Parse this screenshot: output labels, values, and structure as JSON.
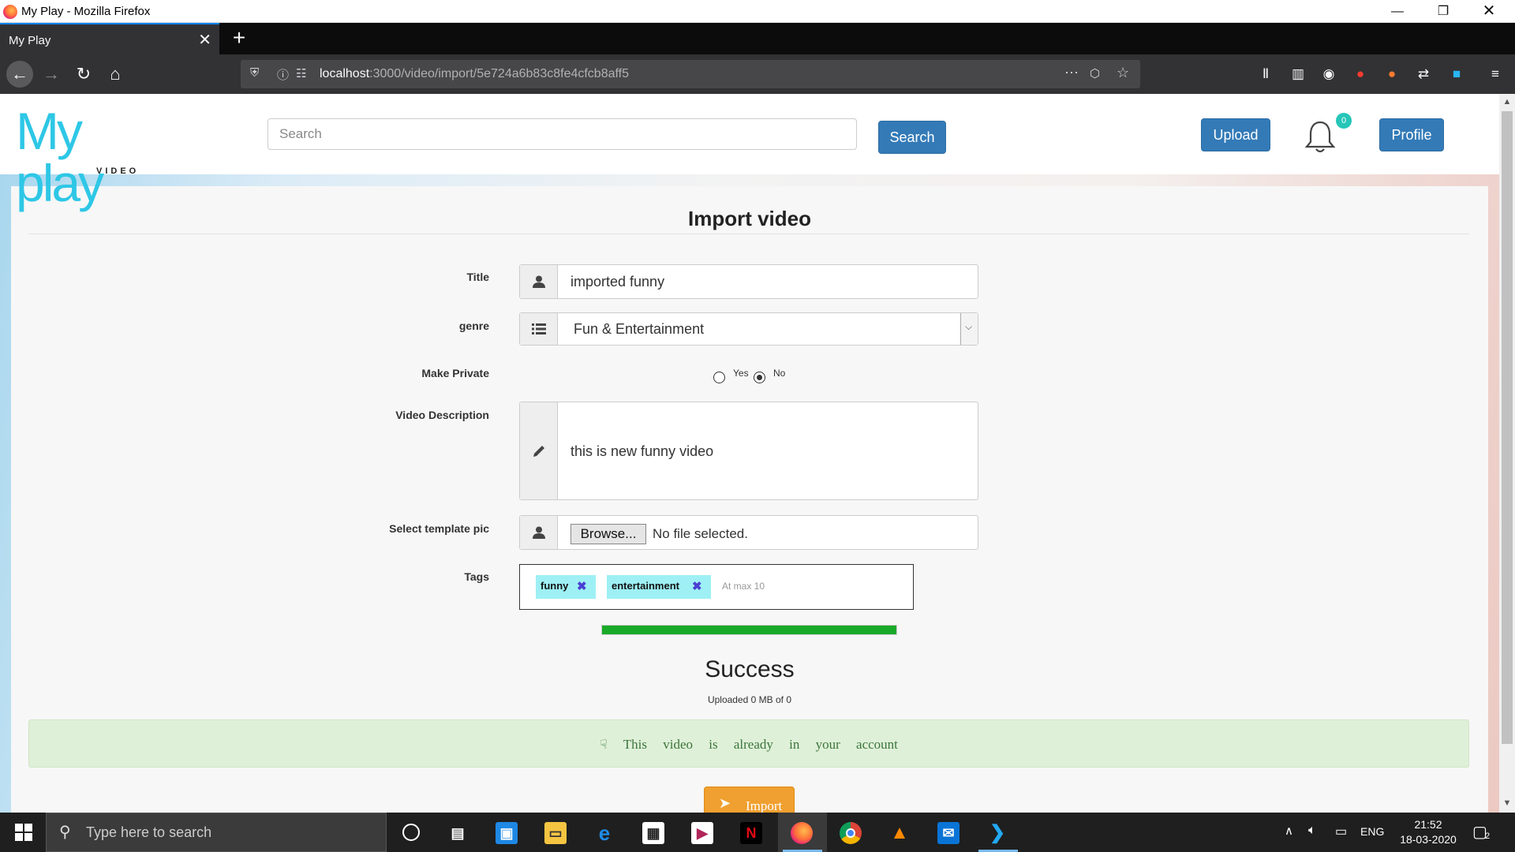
{
  "window": {
    "title": "My Play - Mozilla Firefox"
  },
  "tab": {
    "label": "My Play"
  },
  "url": {
    "host": "localhost",
    "rest": ":3000/video/import/5e724a6b83c8fe4cfcb8aff5"
  },
  "header": {
    "logo_main": "My play",
    "logo_sub": "VIDEO",
    "search_placeholder": "Search",
    "search_button": "Search",
    "upload_button": "Upload",
    "notification_count": "0",
    "profile_button": "Profile"
  },
  "form": {
    "heading": "Import video",
    "title_label": "Title",
    "title_value": "imported funny",
    "genre_label": "genre",
    "genre_value": "Fun & Entertainment",
    "private_label": "Make Private",
    "private_yes": "Yes",
    "private_no": "No",
    "private_selected": "No",
    "description_label": "Video Description",
    "description_value": "this is new funny video",
    "template_label": "Select template pic",
    "browse_button": "Browse...",
    "file_status": "No file selected.",
    "tags_label": "Tags",
    "tags": [
      {
        "text": "funny"
      },
      {
        "text": "entertainment"
      }
    ],
    "tags_placeholder": "At max 10",
    "progress": 1.0,
    "status": "Success",
    "uploaded_text": "Uploaded 0 MB of 0",
    "alert_text": "This video is already in your account",
    "import_button": "Import"
  },
  "taskbar": {
    "search_placeholder": "Type here to search",
    "language": "ENG",
    "time": "21:52",
    "date": "18-03-2020",
    "notification_count": "2"
  },
  "colors": {
    "accent_blue": "#337ab7",
    "logo_cyan": "#2ec7e6",
    "success_green": "#1aaa2a",
    "alert_bg": "#dff0d8",
    "import_orange": "#f0a030"
  }
}
